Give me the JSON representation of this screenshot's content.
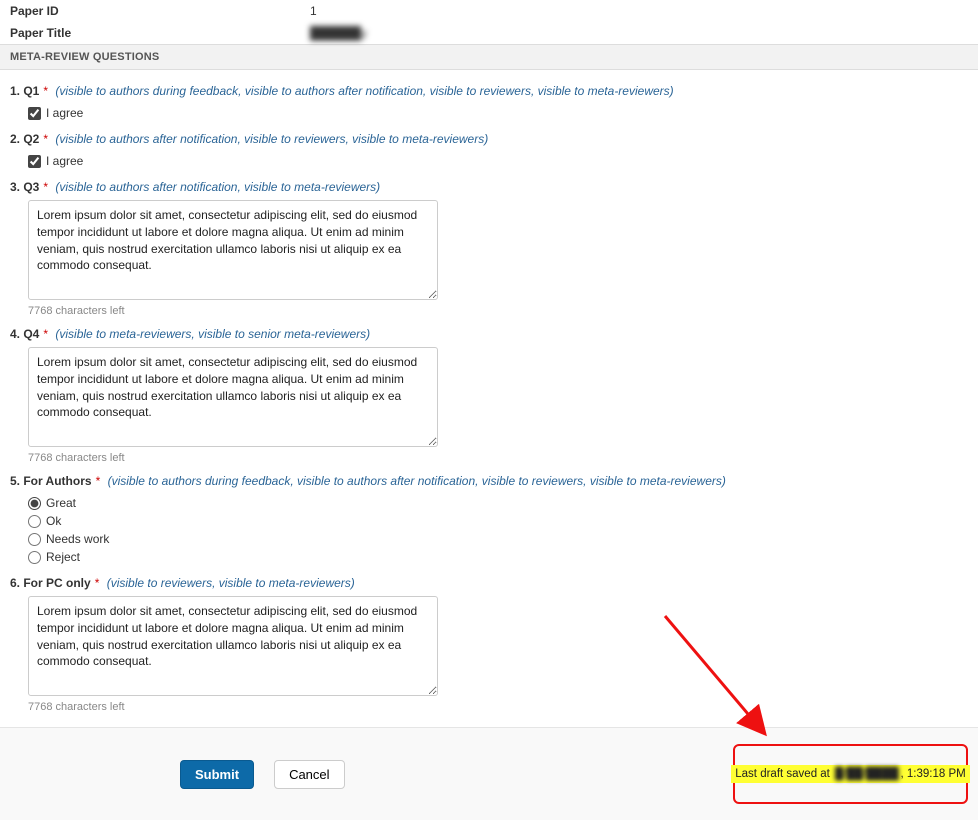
{
  "meta": {
    "paper_id_label": "Paper ID",
    "paper_id_value": "1",
    "paper_title_label": "Paper Title",
    "paper_title_value": "██████y"
  },
  "section_header": "META-REVIEW QUESTIONS",
  "lorem": "Lorem ipsum dolor sit amet, consectetur adipiscing elit, sed do eiusmod tempor incididunt ut labore et dolore magna aliqua. Ut enim ad minim veniam, quis nostrud exercitation ullamco laboris nisi ut aliquip ex ea commodo consequat.",
  "q1": {
    "num": "1. Q1",
    "vis": "(visible to authors during feedback, visible to authors after notification, visible to reviewers, visible to meta-reviewers)",
    "agree": "I agree"
  },
  "q2": {
    "num": "2. Q2",
    "vis": "(visible to authors after notification, visible to reviewers, visible to meta-reviewers)",
    "agree": "I agree"
  },
  "q3": {
    "num": "3. Q3",
    "vis": "(visible to authors after notification, visible to meta-reviewers)",
    "chars": "7768 characters left"
  },
  "q4": {
    "num": "4. Q4",
    "vis": "(visible to meta-reviewers, visible to senior meta-reviewers)",
    "chars": "7768 characters left"
  },
  "q5": {
    "num": "5. For Authors",
    "vis": "(visible to authors during feedback, visible to authors after notification, visible to reviewers, visible to meta-reviewers)",
    "opts": [
      "Great",
      "Ok",
      "Needs work",
      "Reject"
    ]
  },
  "q6": {
    "num": "6. For PC only",
    "vis": "(visible to reviewers, visible to meta-reviewers)",
    "chars": "7768 characters left"
  },
  "footer": {
    "submit": "Submit",
    "cancel": "Cancel",
    "saved_prefix": "Last draft saved at ",
    "saved_date": "█/██/████",
    "saved_time": ", 1:39:18 PM"
  }
}
